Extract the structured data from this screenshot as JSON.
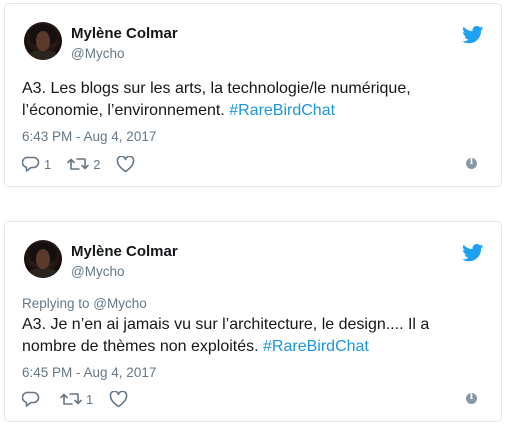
{
  "colors": {
    "accent": "#1b95e0",
    "muted": "#657786",
    "text": "#14171a",
    "border": "#e1e8ed"
  },
  "tweets": [
    {
      "author_name": "Mylène Colmar",
      "author_handle": "@Mycho",
      "reply_to": "",
      "text": "A3. Les blogs sur les arts, la technologie/le numérique, l’économie, l’environnement. ",
      "hashtag": "#RareBirdChat",
      "timestamp": "6:43 PM - Aug 4, 2017",
      "reply_count": "1",
      "retweet_count": "2",
      "like_count": ""
    },
    {
      "author_name": "Mylène Colmar",
      "author_handle": "@Mycho",
      "reply_to": "Replying to @Mycho",
      "text": "A3. Je n’en ai jamais vu sur l’architecture, le design.... Il a nombre de thèmes non exploités. ",
      "hashtag": "#RareBirdChat",
      "timestamp": "6:45 PM - Aug 4, 2017",
      "reply_count": "",
      "retweet_count": "1",
      "like_count": ""
    }
  ],
  "icons": {
    "brand": "twitter-bird-icon",
    "reply": "reply-icon",
    "retweet": "retweet-icon",
    "like": "heart-icon",
    "info": "info-icon"
  }
}
